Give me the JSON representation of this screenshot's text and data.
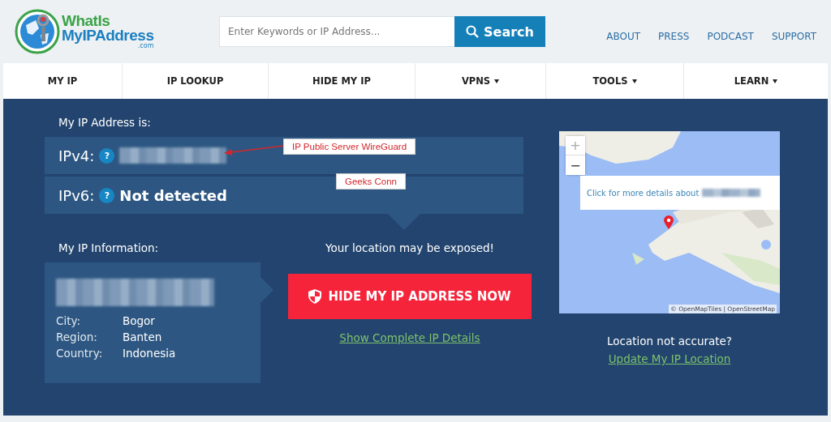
{
  "logo": {
    "line_1": "WhatIs",
    "line_2": "MyIPAddress",
    "suffix": ".com"
  },
  "search": {
    "placeholder": "Enter Keywords or IP Address...",
    "button": "Search"
  },
  "top_links": [
    "ABOUT",
    "PRESS",
    "PODCAST",
    "SUPPORT"
  ],
  "nav": [
    {
      "label": "MY IP",
      "dropdown": false
    },
    {
      "label": "IP LOOKUP",
      "dropdown": false
    },
    {
      "label": "HIDE MY IP",
      "dropdown": false
    },
    {
      "label": "VPNS",
      "dropdown": true
    },
    {
      "label": "TOOLS",
      "dropdown": true
    },
    {
      "label": "LEARN",
      "dropdown": true
    }
  ],
  "ip_section": {
    "heading": "My IP Address is:",
    "rows": [
      {
        "label": "IPv4:",
        "help": "?",
        "value_redacted": true
      },
      {
        "label": "IPv6:",
        "help": "?",
        "value": "Not detected",
        "value_redacted": false
      }
    ]
  },
  "annotations": [
    "IP Public Server WireGuard",
    "Geeks Conn"
  ],
  "info": {
    "heading": "My IP Information:",
    "fields": [
      {
        "label": "City:",
        "value": "Bogor"
      },
      {
        "label": "Region:",
        "value": "Banten"
      },
      {
        "label": "Country:",
        "value": "Indonesia"
      }
    ]
  },
  "cta": {
    "warning": "Your location may be exposed!",
    "button": "HIDE MY IP ADDRESS NOW",
    "link": "Show Complete IP Details"
  },
  "map": {
    "kind": "picture",
    "popup": "Click for more details about",
    "attribution": "© OpenMapTiles | OpenStreetMap",
    "zoom_in": "+",
    "zoom_out": "−"
  },
  "location": {
    "question": "Location not accurate?",
    "link": "Update My IP Location"
  }
}
